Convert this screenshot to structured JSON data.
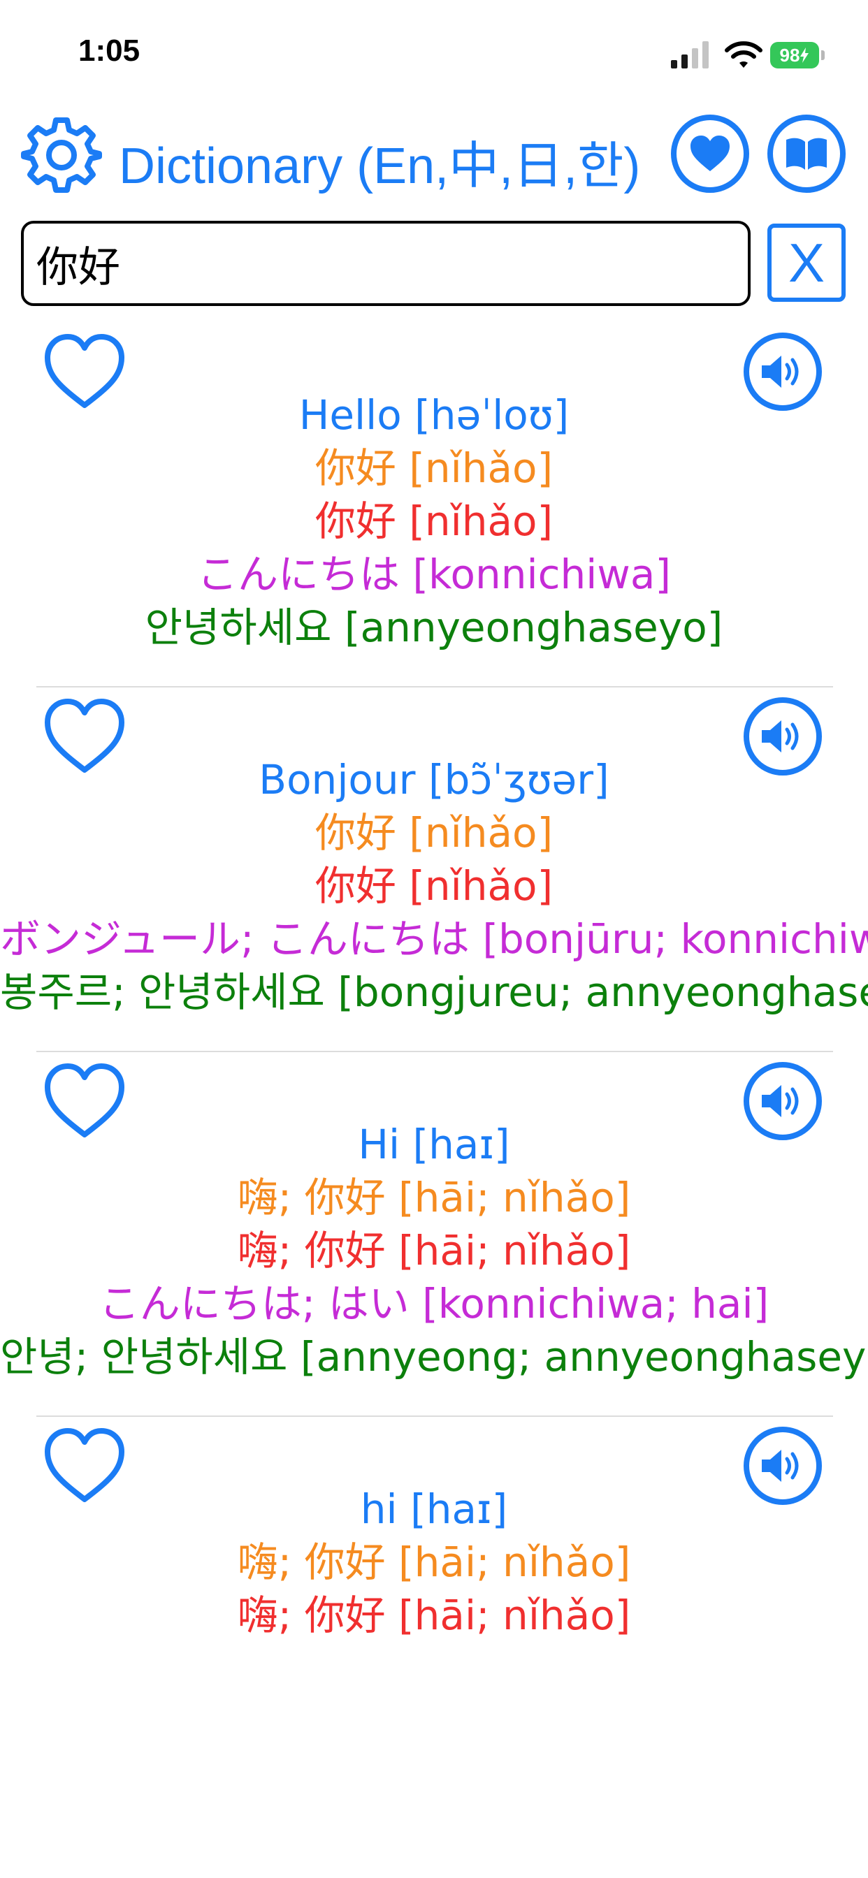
{
  "status_bar": {
    "time": "1:05",
    "battery": "98"
  },
  "header": {
    "title": "Dictionary (En,中,日,한)"
  },
  "search": {
    "value": "你好",
    "clear_label": "X"
  },
  "icons": {
    "settings": "gear-icon",
    "favorites": "heart-filled-icon",
    "dictionary": "book-icon",
    "favorite_toggle": "heart-outline-icon",
    "speak": "speaker-icon"
  },
  "colors": {
    "accent": "#1b7cf5",
    "english": "#1b7cf5",
    "chinese_simplified": "#f58b20",
    "chinese_traditional": "#f02f2f",
    "japanese": "#c52bd6",
    "korean": "#0c800c"
  },
  "entries": [
    {
      "en": "Hello  [həˈloʊ]",
      "zh_s": "你好  [nǐhǎo]",
      "zh_t": "你好  [nǐhǎo]",
      "ja": "こんにちは  [konnichiwa]",
      "ko": "안녕하세요  [annyeonghaseyo]"
    },
    {
      "en": "Bonjour  [bɔ̃ˈʒʊər]",
      "zh_s": "你好  [nǐhǎo]",
      "zh_t": "你好  [nǐhǎo]",
      "ja": "ボンジュール; こんにちは  [bonjūru; konnichiwa]",
      "ko": "봉주르; 안녕하세요  [bongjureu; annyeonghaseyo]"
    },
    {
      "en": "Hi  [haɪ]",
      "zh_s": "嗨; 你好  [hāi; nǐhǎo]",
      "zh_t": "嗨; 你好  [hāi; nǐhǎo]",
      "ja": "こんにちは; はい  [konnichiwa; hai]",
      "ko": "안녕; 안녕하세요  [annyeong; annyeonghaseyo]"
    },
    {
      "en": "hi  [haɪ]",
      "zh_s": "嗨; 你好  [hāi; nǐhǎo]",
      "zh_t": "嗨; 你好  [hāi; nǐhǎo]"
    }
  ]
}
